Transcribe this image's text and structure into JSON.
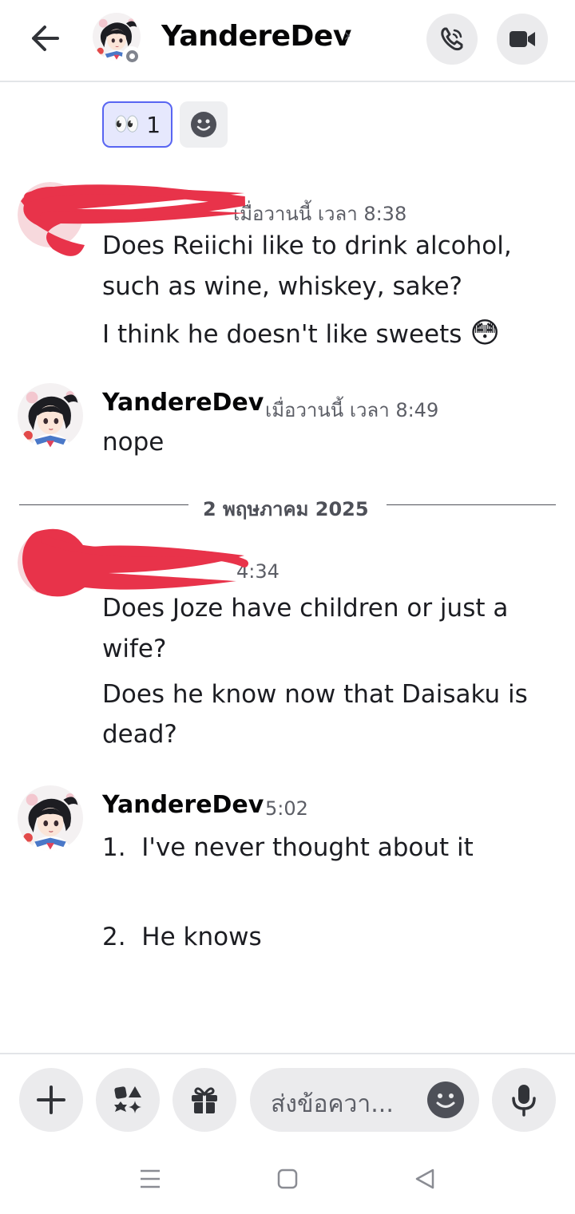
{
  "header": {
    "title": "YandereDev",
    "chevron": "›",
    "back_icon": "arrow-left-icon",
    "call_icon": "phone-icon",
    "video_icon": "video-camera-icon"
  },
  "reactions": {
    "active": {
      "emoji": "👀",
      "count": "1"
    },
    "add_icon": "smiley-add-icon"
  },
  "messages": [
    {
      "author_visible": "",
      "timestamp": "เมื่อวานนี้ เวลา 8:38",
      "lines": [
        "Does Reiichi like to drink alcohol,",
        "such as wine, whiskey, sake?",
        "I think he doesn't like sweets"
      ],
      "emoji": "😳",
      "redacted": true
    },
    {
      "author": "YandereDev",
      "timestamp": "เมื่อวานนี้ เวลา 8:49",
      "lines": [
        "nope"
      ]
    },
    {
      "author_visible": "",
      "timestamp": "4:34",
      "lines": [
        "Does Joze have children or just a",
        "wife?",
        "Does he know now that Daisaku is",
        "dead?"
      ],
      "redacted": true
    },
    {
      "author": "YandereDev",
      "timestamp": "5:02",
      "lines": [
        "1.  I've never thought about it",
        "2.  He knows"
      ]
    }
  ],
  "date_divider": "2 พฤษภาคม 2025",
  "composer": {
    "placeholder": "ส่งข้อควา...",
    "plus_icon": "plus-icon",
    "apps_icon": "apps-icon",
    "gift_icon": "gift-icon",
    "emoji_icon": "emoji-icon",
    "mic_icon": "microphone-icon"
  },
  "system_nav": {
    "recents_icon": "recents-icon",
    "home_icon": "home-icon",
    "back_icon": "back-triangle-icon"
  },
  "colors": {
    "accent": "#5865f2",
    "redaction": "#e8334a",
    "button_bg": "#ebebed"
  }
}
